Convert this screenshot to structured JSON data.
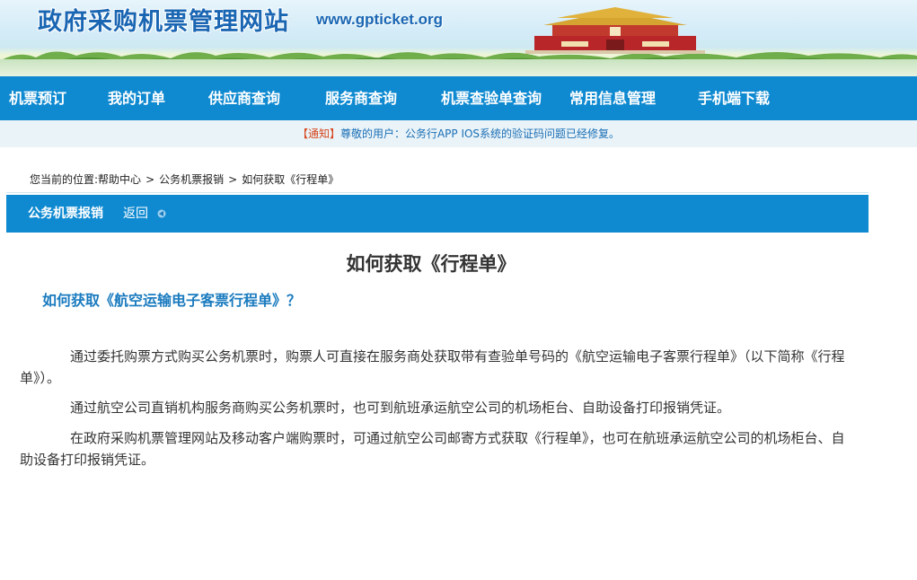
{
  "header": {
    "site_title": "政府采购机票管理网站",
    "site_url": "www.gpticket.org"
  },
  "nav": {
    "items": [
      {
        "label": "机票预订"
      },
      {
        "label": "我的订单"
      },
      {
        "label": "供应商查询"
      },
      {
        "label": "服务商查询"
      },
      {
        "label": "机票查验单查询"
      },
      {
        "label": "常用信息管理"
      },
      {
        "label": "手机端下载"
      }
    ]
  },
  "notice": {
    "tag": "【通知】",
    "message": "尊敬的用户：公务行APP IOS系统的验证码问题已经修复。"
  },
  "breadcrumb": {
    "prefix": "您当前的位置:",
    "items": [
      "帮助中心",
      "公务机票报销",
      "如何获取《行程单》"
    ],
    "separator": ">"
  },
  "section": {
    "title": "公务机票报销",
    "back_label": "返回"
  },
  "article": {
    "title": "如何获取《行程单》",
    "subtitle": "如何获取《航空运输电子客票行程单》？",
    "paragraphs": [
      "通过委托购票方式购买公务机票时，购票人可直接在服务商处获取带有查验单号码的《航空运输电子客票行程单》（以下简称《行程单》）。",
      "通过航空公司直销机构服务商购买公务机票时，也可到航班承运航空公司的机场柜台、自助设备打印报销凭证。",
      "在政府采购机票管理网站及移动客户端购票时，可通过航空公司邮寄方式获取《行程单》，也可在航班承运航空公司的机场柜台、自助设备打印报销凭证。"
    ]
  },
  "colors": {
    "nav_bg": "#0f8ad1",
    "subtitle": "#1a7bbf",
    "notice_tag": "#d6471f",
    "notice_bg": "#eaf3f8"
  },
  "icons": {
    "back": "back-arrow-icon",
    "banner": "tiananmen-gate-image"
  }
}
